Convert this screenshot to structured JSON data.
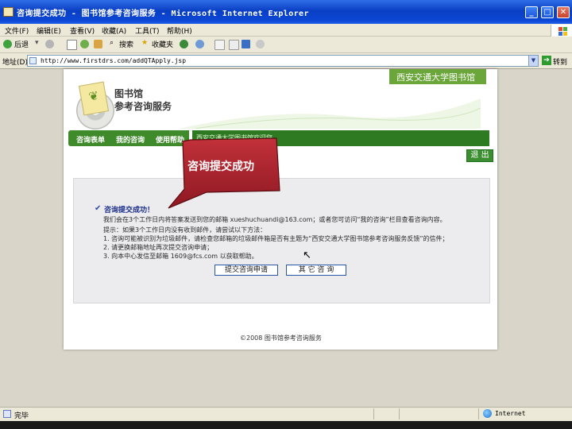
{
  "window": {
    "title": "咨询提交成功 - 图书馆参考咨询服务 - Microsoft Internet Explorer",
    "minimize_glyph": "_",
    "maximize_glyph": "□",
    "close_glyph": "✕"
  },
  "menu": {
    "items": [
      "文件(F)",
      "编辑(E)",
      "查看(V)",
      "收藏(A)",
      "工具(T)",
      "帮助(H)"
    ]
  },
  "toolbar": {
    "back": "后退",
    "search": "搜索",
    "favorites": "收藏夹"
  },
  "address": {
    "label": "地址(D)",
    "url": "http://www.firstdrs.com/addQTApply.jsp",
    "go": "转到"
  },
  "site": {
    "university": "西安交通大学图书馆",
    "title_line1": "图书馆",
    "title_line2": "参考咨询服务",
    "nav": [
      "咨询表单",
      "我的咨询",
      "使用帮助"
    ],
    "nav_marquee": "西安交通大学图书馆欢迎您",
    "logout": "退 出"
  },
  "callout": {
    "text": "咨询提交成功"
  },
  "result": {
    "icon": "✔",
    "title": "咨询提交成功！",
    "lines": [
      "我们会在3个工作日内将答案发送到您的邮箱 xueshuchuandi@163.com；或者您可访问“我的咨询”栏目查看咨询内容。",
      "提示：如果3个工作日内没有收到邮件，请尝试以下方法：",
      "1. 咨询可能被识别为垃圾邮件，请检查您邮箱的垃圾邮件箱是否有主题为“西安交通大学图书馆参考咨询服务反馈”的信件；",
      "2. 请更换邮箱地址再次提交咨询申请；",
      "3. 向本中心发信至邮箱 1609@fcs.com 以获取帮助。"
    ],
    "btn_print": "提交咨询申请",
    "btn_other": "其 它 咨 询"
  },
  "footer": {
    "text": "©2008 图书馆参考咨询服务"
  },
  "status": {
    "left": "完毕",
    "zone": "Internet"
  },
  "colors": {
    "titlebar": "#0a3fc3",
    "nav_green": "#3f8a2b",
    "header_band": "#6aa639",
    "callout_red": "#a8202a"
  }
}
